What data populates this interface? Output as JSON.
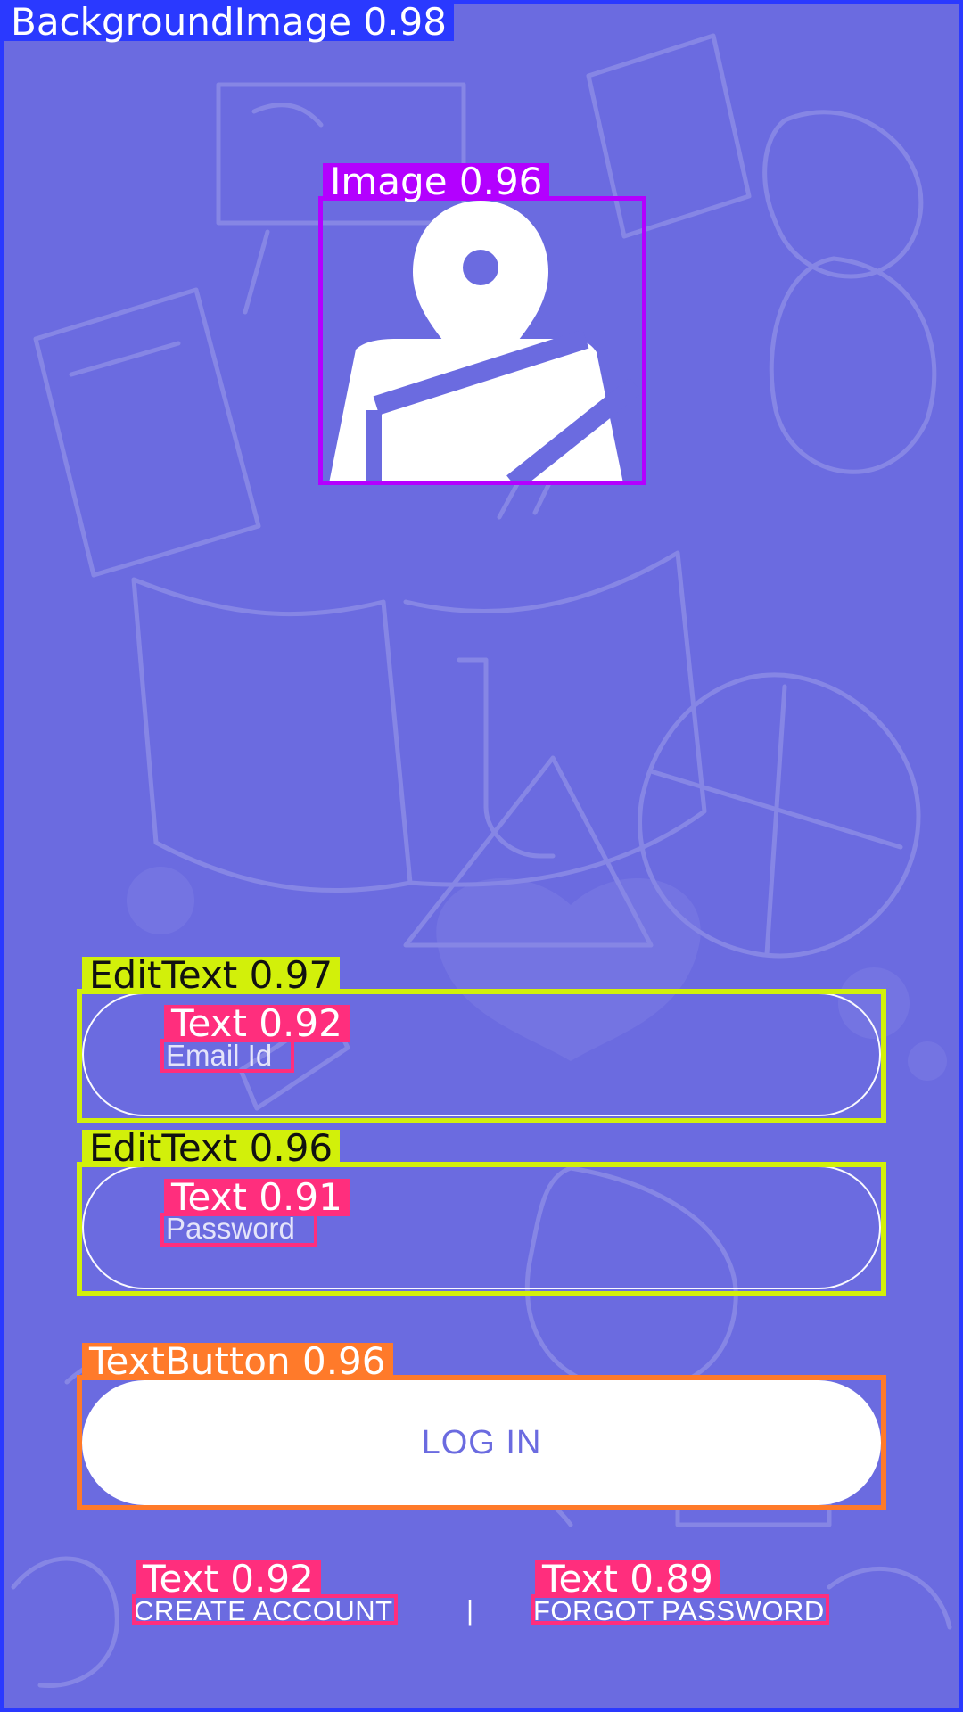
{
  "background": {
    "label": "BackgroundImage 0.98",
    "color": "#6b6be0"
  },
  "logo": {
    "label": "Image 0.96",
    "icon": "map-pin-icon"
  },
  "email_field": {
    "label": "EditText 0.97",
    "text_label": "Text 0.92",
    "placeholder": "Email Id"
  },
  "password_field": {
    "label": "EditText 0.96",
    "text_label": "Text 0.91",
    "placeholder": "Password"
  },
  "login_button": {
    "label": "TextButton 0.96",
    "text": "LOG IN"
  },
  "links": {
    "create_account": {
      "label": "Text 0.92",
      "text": "CREATE ACCOUNT"
    },
    "separator": "|",
    "forgot_password": {
      "label": "Text 0.89",
      "text": "FORGOT PASSWORD"
    }
  }
}
